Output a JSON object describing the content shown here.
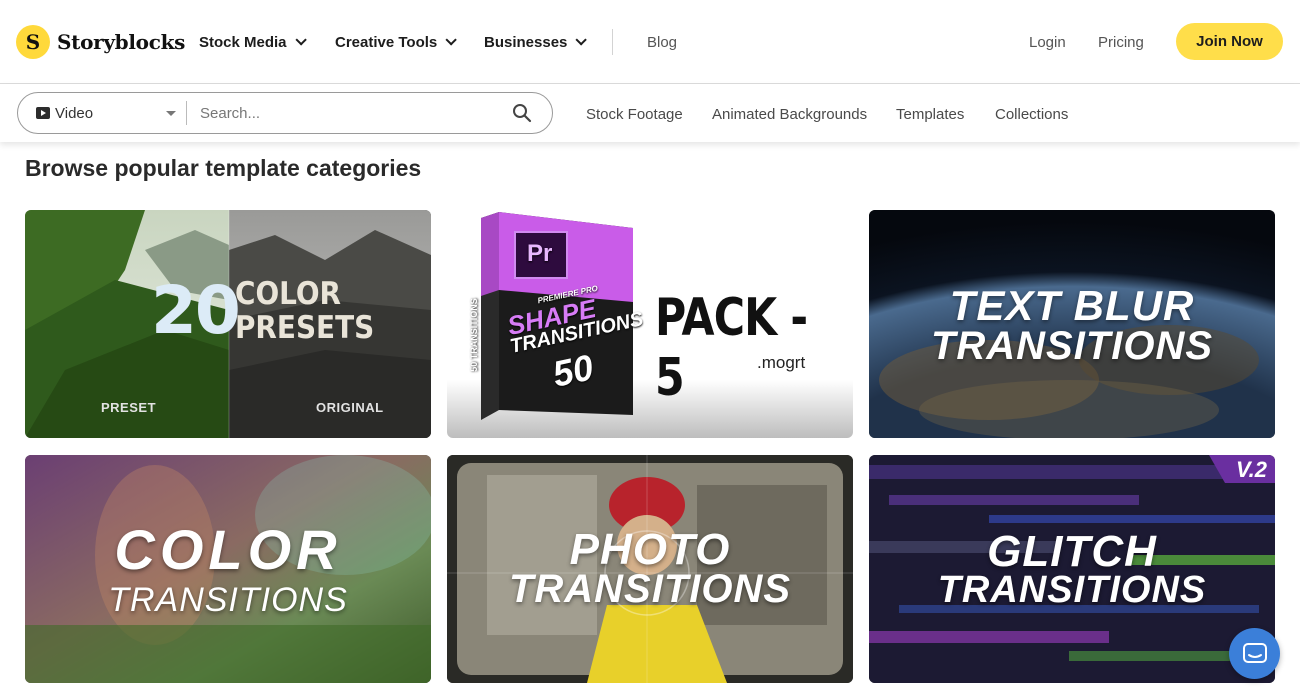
{
  "header": {
    "logo_text": "Storyblocks",
    "logo_mark": "S",
    "nav": [
      {
        "label": "Stock Media"
      },
      {
        "label": "Creative Tools"
      },
      {
        "label": "Businesses"
      }
    ],
    "blog_label": "Blog",
    "login_label": "Login",
    "pricing_label": "Pricing",
    "join_label": "Join Now",
    "accent_color": "#ffde4a"
  },
  "search": {
    "media_type": "Video",
    "placeholder": "Search...",
    "links": [
      "Stock Footage",
      "Animated Backgrounds",
      "Templates",
      "Collections"
    ]
  },
  "main": {
    "section_title": "Browse popular template categories",
    "cards": [
      {
        "line1": "20",
        "line2": "COLOR",
        "line3": "PRESETS",
        "left_label": "PRESET",
        "right_label": "ORIGINAL"
      },
      {
        "brand": "Pr",
        "box_line1": "PREMIERE PRO",
        "box_line2": "SHAPE",
        "box_line3": "TRANSITIONS",
        "box_line4": "50",
        "box_side": "50 TRANSITIONS",
        "big": "PACK - 5",
        "small": ".mogrt"
      },
      {
        "line1": "TEXT BLUR",
        "line2": "TRANSITIONS"
      },
      {
        "line1": "COLOR",
        "line2": "TRANSITIONS"
      },
      {
        "line1": "PHOTO",
        "line2": "TRANSITIONS"
      },
      {
        "line1": "GLITCH",
        "line2": "TRANSITIONS",
        "badge": "V.2"
      }
    ]
  },
  "chat": {
    "icon": "chat-icon"
  }
}
